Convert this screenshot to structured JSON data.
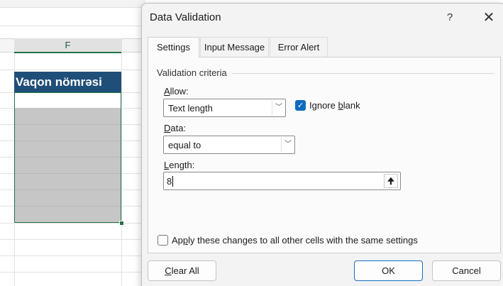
{
  "spreadsheet": {
    "column_letter": "F",
    "header_cell_text": "Vaqon nömrəsi"
  },
  "dialog": {
    "title": "Data Validation",
    "help_label": "?",
    "close_label": "✕",
    "tabs": [
      {
        "label": "Settings",
        "active": true
      },
      {
        "label": "Input Message",
        "active": false
      },
      {
        "label": "Error Alert",
        "active": false
      }
    ],
    "criteria_label": "Validation criteria",
    "allow": {
      "label_accel": "A",
      "label_rest": "llow:",
      "value": "Text length"
    },
    "ignore_blank": {
      "label_pre": "Ignore ",
      "label_accel": "b",
      "label_post": "lank",
      "checked": true
    },
    "data": {
      "label_accel": "D",
      "label_rest": "ata:",
      "value": "equal to"
    },
    "length": {
      "label_accel": "L",
      "label_rest": "ength:",
      "value": "8"
    },
    "apply_all": {
      "label_pre": "Ap",
      "label_accel": "p",
      "label_post": "ly these changes to all other cells with the same settings",
      "checked": false
    },
    "buttons": {
      "clear_all_accel": "C",
      "clear_all_rest": "lear All",
      "ok": "OK",
      "cancel": "Cancel"
    }
  },
  "icons": {
    "dropdown": "chevron-down-icon",
    "check": "checkmark-icon",
    "collapse": "collapse-dialog-icon"
  },
  "colors": {
    "header_fill": "#1f4e79",
    "selection_border": "#217346",
    "checkbox_accent": "#0f6cbd"
  }
}
